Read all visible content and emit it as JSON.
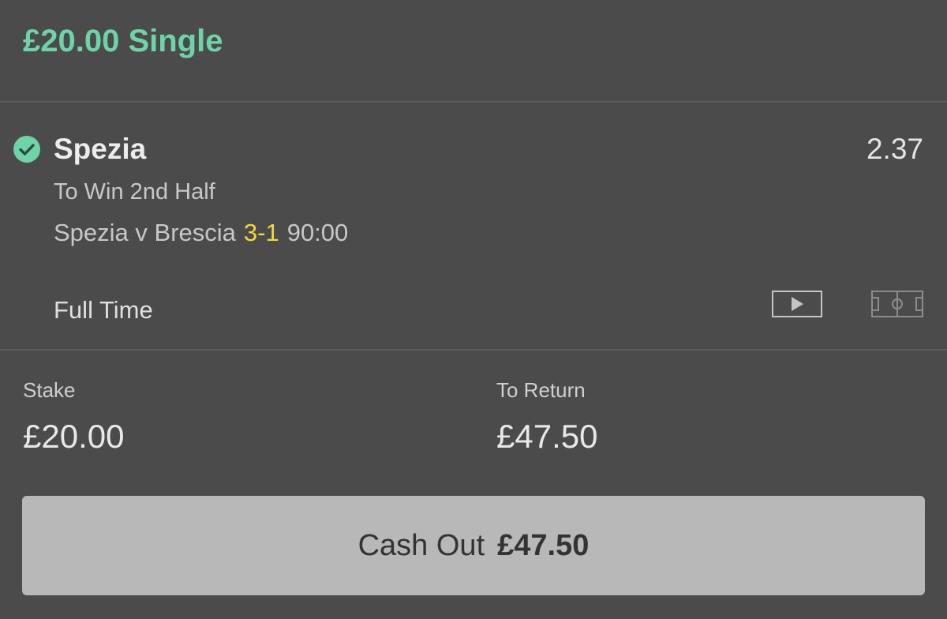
{
  "bet": {
    "title": "£20.00 Single"
  },
  "selection": {
    "name": "Spezia",
    "odds": "2.37",
    "market": "To Win 2nd Half",
    "event": "Spezia v Brescia",
    "score": "3-1",
    "clock": "90:00",
    "status": "Full Time",
    "result_icon": "check-circle-icon",
    "icons": [
      "video-play-icon",
      "pitch-icon"
    ]
  },
  "stake": {
    "label": "Stake",
    "value": "£20.00"
  },
  "to_return": {
    "label": "To Return",
    "value": "£47.50"
  },
  "cashout": {
    "label": "Cash Out",
    "amount": "£47.50"
  },
  "colors": {
    "background": "#4b4b4b",
    "accent_green": "#6fd3a8",
    "score_yellow": "#f4d83d",
    "button_grey": "#b8b8b8"
  }
}
